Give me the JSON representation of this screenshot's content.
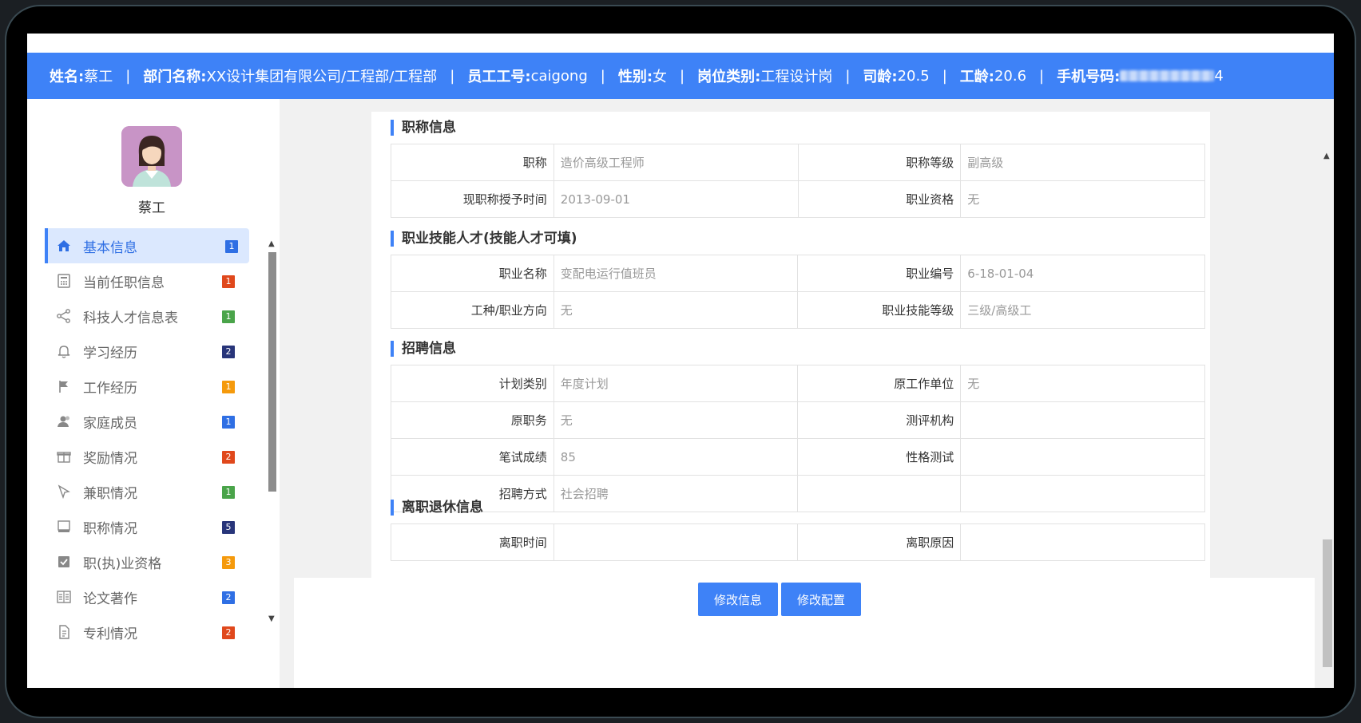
{
  "header": {
    "fields": [
      {
        "key": "姓名:",
        "value": "蔡工"
      },
      {
        "key": "部门名称:",
        "value": "XX设计集团有限公司/工程部/工程部"
      },
      {
        "key": "员工工号:",
        "value": "caigong"
      },
      {
        "key": "性别:",
        "value": "女"
      },
      {
        "key": "岗位类别:",
        "value": "工程设计岗"
      },
      {
        "key": "司龄:",
        "value": "20.5"
      },
      {
        "key": "工龄:",
        "value": "20.6"
      }
    ],
    "phone_key": "手机号码:",
    "phone_suffix": "4",
    "separator": "|"
  },
  "sidebar": {
    "user_name": "蔡工",
    "items": [
      {
        "label": "基本信息",
        "badge": "1",
        "badge_color": "#2f6fe4",
        "icon": "home-icon",
        "active": true
      },
      {
        "label": "当前任职信息",
        "badge": "1",
        "badge_color": "#e0481c",
        "icon": "calculator-icon"
      },
      {
        "label": "科技人才信息表",
        "badge": "1",
        "badge_color": "#4aa44a",
        "icon": "share-icon"
      },
      {
        "label": "学习经历",
        "badge": "2",
        "badge_color": "#28357a",
        "icon": "bell-icon"
      },
      {
        "label": "工作经历",
        "badge": "1",
        "badge_color": "#f59a0c",
        "icon": "flag-icon"
      },
      {
        "label": "家庭成员",
        "badge": "1",
        "badge_color": "#2f6fe4",
        "icon": "users-icon"
      },
      {
        "label": "奖励情况",
        "badge": "2",
        "badge_color": "#e0481c",
        "icon": "gift-icon"
      },
      {
        "label": "兼职情况",
        "badge": "1",
        "badge_color": "#4aa44a",
        "icon": "pointer-icon"
      },
      {
        "label": "职称情况",
        "badge": "5",
        "badge_color": "#28357a",
        "icon": "monitor-icon"
      },
      {
        "label": "职(执)业资格",
        "badge": "3",
        "badge_color": "#f59a0c",
        "icon": "checkbox-icon"
      },
      {
        "label": "论文著作",
        "badge": "2",
        "badge_color": "#2f6fe4",
        "icon": "book-icon"
      },
      {
        "label": "专利情况",
        "badge": "2",
        "badge_color": "#e0481c",
        "icon": "document-icon"
      }
    ]
  },
  "sections": {
    "title_info": {
      "title": "职称信息",
      "rows": [
        [
          "职称",
          "造价高级工程师",
          "职称等级",
          "副高级"
        ],
        [
          "现职称授予时间",
          "2013-09-01",
          "职业资格",
          "无"
        ]
      ]
    },
    "skill_info": {
      "title": "职业技能人才(技能人才可填)",
      "rows": [
        [
          "职业名称",
          "变配电运行值班员",
          "职业编号",
          "6-18-01-04"
        ],
        [
          "工种/职业方向",
          "无",
          "职业技能等级",
          "三级/高级工"
        ]
      ]
    },
    "recruit_info": {
      "title": "招聘信息",
      "rows": [
        [
          "计划类别",
          "年度计划",
          "原工作单位",
          "无"
        ],
        [
          "原职务",
          "无",
          "测评机构",
          ""
        ],
        [
          "笔试成绩",
          "85",
          "性格测试",
          ""
        ],
        [
          "招聘方式",
          "社会招聘",
          "",
          ""
        ]
      ]
    },
    "leave_info": {
      "title": "离职退休信息",
      "rows": [
        [
          "离职时间",
          "",
          "离职原因",
          ""
        ]
      ]
    }
  },
  "buttons": {
    "edit_info": "修改信息",
    "edit_config": "修改配置"
  },
  "colors": {
    "accent": "#3e82f7",
    "active_bg": "#dbe8fe"
  }
}
